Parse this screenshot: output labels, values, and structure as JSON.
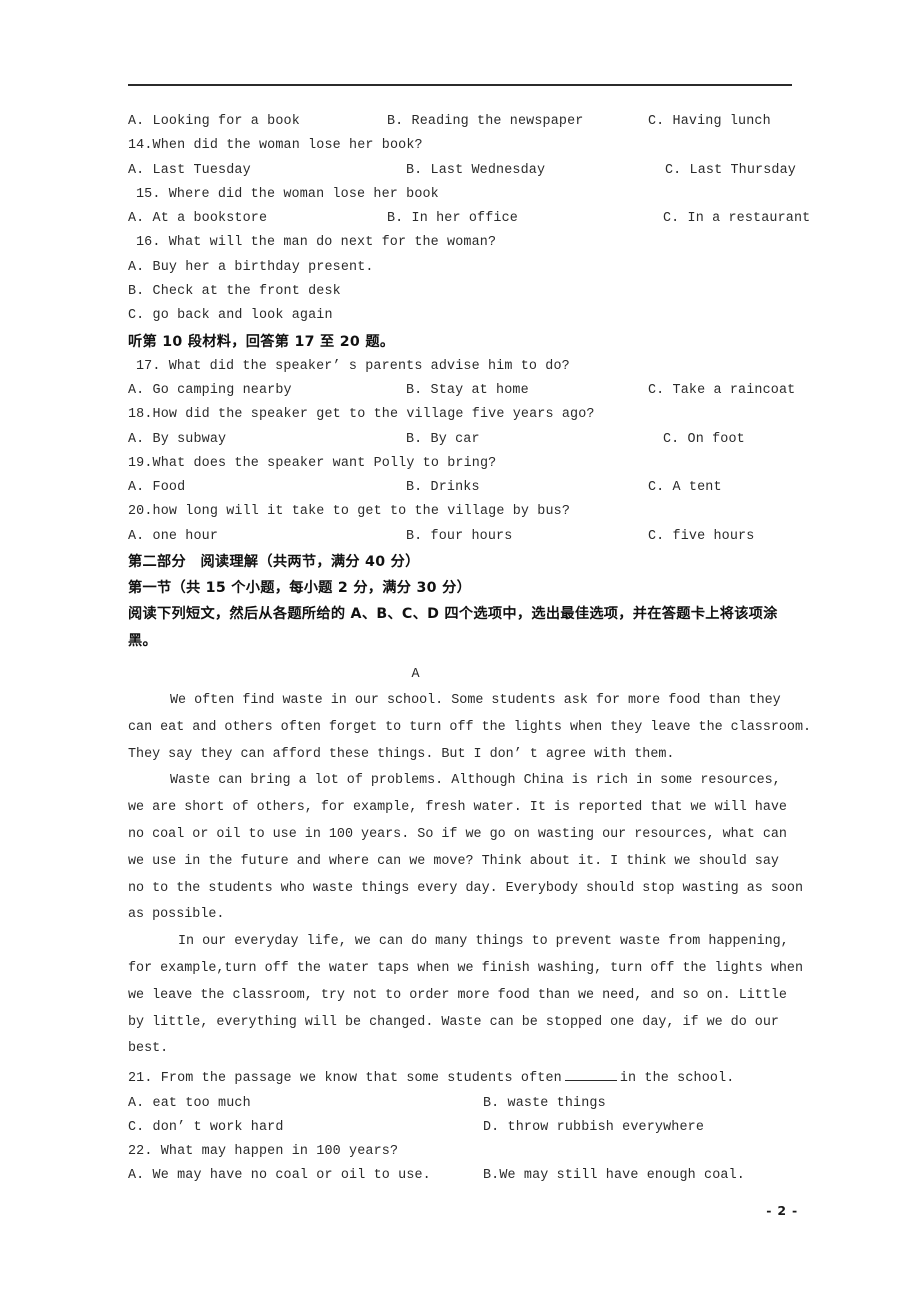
{
  "document": {
    "page_number": "- 2 -",
    "header_rule": true
  },
  "listening_section": {
    "q13_options": {
      "A": "A. Looking for a book",
      "B": "B. Reading the newspaper",
      "C": "C. Having lunch"
    },
    "q14": {
      "stem": "14.When did the woman lose her book?",
      "A": "A. Last Tuesday",
      "B": "B. Last Wednesday",
      "C": "C. Last Thursday"
    },
    "q15": {
      "stem": "15. Where did the woman lose her book",
      "A": "A. At a bookstore",
      "B": "B. In her office",
      "C": "C. In a restaurant"
    },
    "q16": {
      "stem": "16. What will the man do next for the woman?",
      "A": "A. Buy her a birthday present.",
      "B": "B. Check at the front desk",
      "C": "C. go back and look again"
    },
    "material_10_heading": "听第 10 段材料，回答第 17 至 20 题。",
    "q17": {
      "stem": "17. What did the speaker’ s parents advise him to do?",
      "A": "A. Go camping nearby",
      "B": "B. Stay at home",
      "C": "C. Take a raincoat"
    },
    "q18": {
      "stem": "18.How did the speaker get to the village five years ago?",
      "A": "A. By subway",
      "B": "B. By car",
      "C": "C. On foot"
    },
    "q19": {
      "stem": "19.What does the speaker want Polly to bring?",
      "A": "A. Food",
      "B": "B. Drinks",
      "C": "C. A tent"
    },
    "q20": {
      "stem": "20.how long will it take to get to the village by bus?",
      "A": "A. one hour",
      "B": "B. four hours",
      "C": "C. five hours"
    }
  },
  "reading_section": {
    "part_heading": "第二部分　阅读理解（共两节，满分 40 分）",
    "subsection_heading": "第一节（共 15 个小题，每小题 2 分，满分 30 分）",
    "instructions": "阅读下列短文，然后从各题所给的 A、B、C、D 四个选项中，选出最佳选项，并在答题卡上将该项涂黑。",
    "passage_label": "A",
    "passage_lines": [
      "We often find waste in our school. Some students ask for more food than they",
      "can eat and others often forget to turn off  the lights when they leave the classroom.",
      "They say they can afford these things. But I don’ t agree with them.",
      "Waste can bring a lot of problems. Although China is rich in some resources,",
      "we are short of others, for example, fresh water. It is reported that we will have",
      "no coal or oil to use in 100 years. So if we go on wasting our resources, what can",
      "we use in the future and where can we move? Think about it. I think we should say",
      "no to the students who waste things every day. Everybody should stop wasting as soon",
      "as possible.",
      "In our everyday life, we can do many things to prevent waste from happening,",
      "for example,turn off the water taps when we finish washing, turn off the lights when",
      "we leave the classroom, try not to order more food than we need, and so on. Little",
      "by little, everything will be changed. Waste can be stopped one day, if we do our",
      "best."
    ],
    "q21": {
      "stem_before": "21. From the passage we know that some students often",
      "stem_after": "in the school.",
      "A": "A. eat too much",
      "B": "B. waste things",
      "C": "C. don’ t work hard",
      "D": "D. throw rubbish everywhere"
    },
    "q22": {
      "stem": "22. What may happen in 100 years?",
      "A": "A. We may have no coal or oil to use.",
      "B": "B.We may still have enough coal."
    }
  }
}
